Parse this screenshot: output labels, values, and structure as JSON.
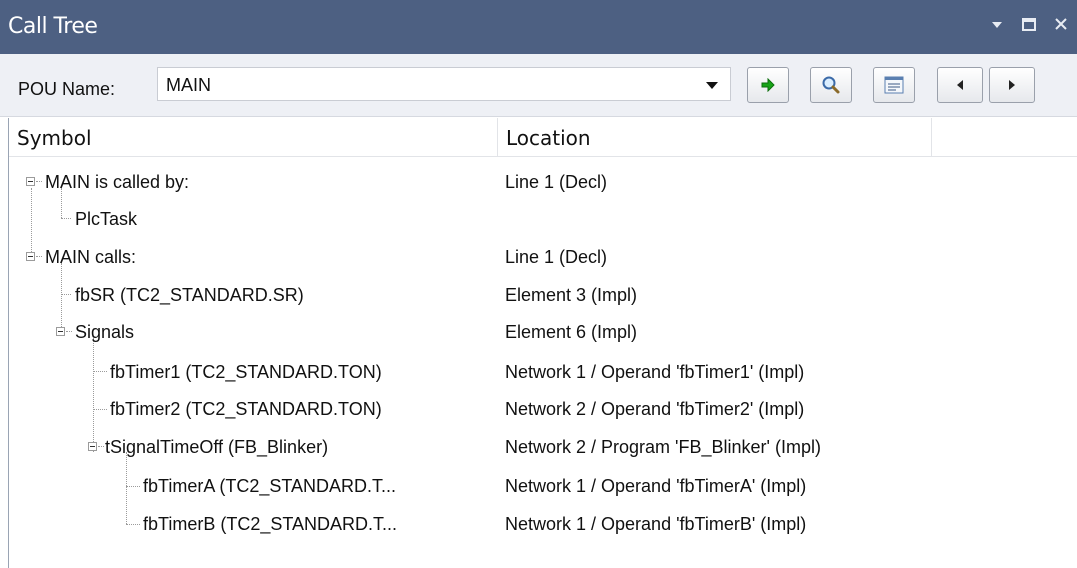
{
  "window": {
    "title": "Call Tree"
  },
  "toolbar": {
    "pou_label": "POU Name:",
    "pou_value": "MAIN"
  },
  "columns": {
    "symbol": "Symbol",
    "location": "Location"
  },
  "rows": [
    {
      "symbol": "MAIN is called by:",
      "location": "Line 1 (Decl)"
    },
    {
      "symbol": "PlcTask",
      "location": ""
    },
    {
      "symbol": "MAIN calls:",
      "location": "Line 1 (Decl)"
    },
    {
      "symbol": "fbSR (TC2_STANDARD.SR)",
      "location": "Element 3 (Impl)"
    },
    {
      "symbol": "Signals",
      "location": "Element 6 (Impl)"
    },
    {
      "symbol": "fbTimer1 (TC2_STANDARD.TON)",
      "location": "Network 1 / Operand 'fbTimer1' (Impl)"
    },
    {
      "symbol": "fbTimer2 (TC2_STANDARD.TON)",
      "location": "Network 2 / Operand 'fbTimer2' (Impl)"
    },
    {
      "symbol": "tSignalTimeOff (FB_Blinker)",
      "location": "Network 2 / Program 'FB_Blinker' (Impl)"
    },
    {
      "symbol": "fbTimerA (TC2_STANDARD.T...",
      "location": "Network 1 / Operand 'fbTimerA' (Impl)"
    },
    {
      "symbol": "fbTimerB (TC2_STANDARD.T...",
      "location": "Network 1 / Operand 'fbTimerB' (Impl)"
    }
  ],
  "icons": [
    "dropdown-icon",
    "pin-icon",
    "maximize-icon",
    "close-icon",
    "combo-arrow-icon",
    "goto-arrow-icon",
    "search-icon",
    "properties-icon",
    "previous-icon",
    "next-icon",
    "collapse-icon"
  ]
}
